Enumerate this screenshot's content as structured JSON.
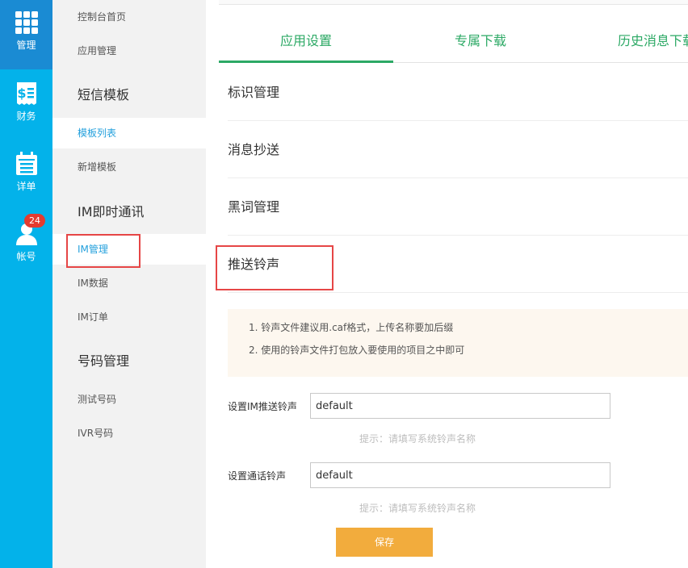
{
  "rail": {
    "items": [
      {
        "label": "管理",
        "icon": "grid-icon"
      },
      {
        "label": "财务",
        "icon": "dollar-receipt-icon"
      },
      {
        "label": "详单",
        "icon": "calendar-list-icon"
      },
      {
        "label": "帐号",
        "icon": "user-icon",
        "badge": "24"
      }
    ]
  },
  "subnav": {
    "console_home": "控制台首页",
    "app_manage": "应用管理",
    "sms_heading": "短信模板",
    "template_list": "模板列表",
    "add_template": "新增模板",
    "im_heading": "IM即时通讯",
    "im_manage": "IM管理",
    "im_data": "IM数据",
    "im_order": "IM订单",
    "number_heading": "号码管理",
    "test_number": "测试号码",
    "ivr_number": "IVR号码"
  },
  "tabs": [
    {
      "label": "应用设置"
    },
    {
      "label": "专属下载"
    },
    {
      "label": "历史消息下载"
    }
  ],
  "sections": {
    "identity": "标识管理",
    "cc": "消息抄送",
    "blacklist": "黑词管理",
    "ringtone": "推送铃声"
  },
  "notice": {
    "line1": "1. 铃声文件建议用.caf格式，上传名称要加后缀",
    "line2": "2. 使用的铃声文件打包放入要使用的项目之中即可"
  },
  "form": {
    "im_label": "设置IM推送铃声",
    "im_value": "default",
    "im_hint": "提示：请填写系统铃声名称",
    "call_label": "设置通话铃声",
    "call_value": "default",
    "call_hint": "提示：请填写系统铃声名称",
    "save_label": "保存"
  },
  "colors": {
    "rail": "#03b2ea",
    "rail_active": "#1a8bd3",
    "accent_green": "#2ca965",
    "save": "#f2ac3d",
    "highlight_red": "#e64646"
  }
}
